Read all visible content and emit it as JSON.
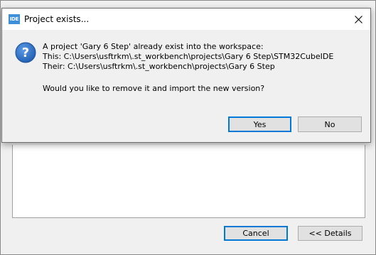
{
  "parent_dialog": {
    "cancel_label": "Cancel",
    "details_label": "<< Details"
  },
  "dialog": {
    "app_icon_text": "IDE",
    "title": "Project exists...",
    "message": {
      "line1": "A project 'Gary 6 Step' already exist into the workspace:",
      "line2": "This: C:\\Users\\usftrkm\\.st_workbench\\projects\\Gary 6 Step\\STM32CubeIDE",
      "line3": "Their: C:\\Users\\usftrkm\\.st_workbench\\projects\\Gary 6 Step",
      "line4": "Would you like to remove it and import the new version?"
    },
    "yes_label": "Yes",
    "no_label": "No"
  },
  "icons": {
    "app": "ide-app-icon",
    "close": "close-icon",
    "question": "question-icon"
  },
  "colors": {
    "accent": "#0078d7",
    "question_icon": "#1e5db1"
  }
}
